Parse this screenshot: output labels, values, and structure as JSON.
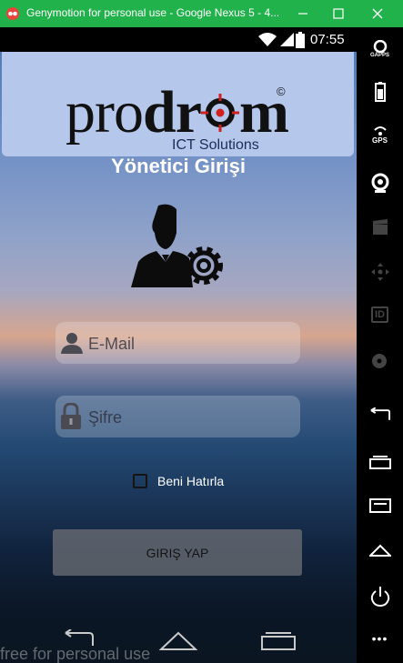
{
  "window": {
    "title": "Genymotion for personal use - Google Nexus 5 - 4...",
    "minimize_glyph": "—",
    "maximize_glyph": "☐",
    "close_glyph": "✕"
  },
  "statusbar": {
    "time": "07:55"
  },
  "logo": {
    "prefix": "pro",
    "middle": "dr",
    "suffix": "m",
    "copyright": "©",
    "subtitle": "ICT Solutions"
  },
  "login": {
    "title": "Yönetici Girişi",
    "email_placeholder": "E-Mail",
    "password_placeholder": "Şifre",
    "remember_label": "Beni Hatırla",
    "login_button": "GIRIŞ YAP"
  },
  "sidebar": {
    "gaps_label": "GAPPS",
    "gps_label": "GPS",
    "id_label": "ID",
    "more_glyph": "•••",
    "accent": "#ffffff"
  },
  "watermark": "free for personal use",
  "colors": {
    "titlebar": "#22b24c",
    "logo_panel": "#b6c7ec",
    "target_red": "#d21f1f"
  }
}
